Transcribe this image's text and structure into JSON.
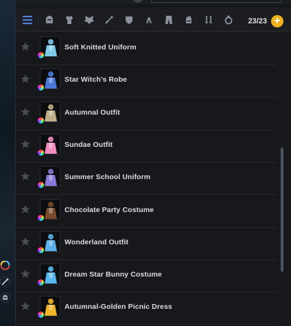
{
  "header": {
    "count": "23/23",
    "add_label": "+"
  },
  "toolbar": {
    "filters": [
      {
        "icon": "list-menu-icon"
      },
      {
        "icon": "helmet-icon"
      },
      {
        "icon": "armor-icon"
      },
      {
        "icon": "wings-icon"
      },
      {
        "icon": "sword-icon"
      },
      {
        "icon": "shield-icon"
      },
      {
        "icon": "claw-icon"
      },
      {
        "icon": "pants-icon"
      },
      {
        "icon": "gauntlet-icon"
      },
      {
        "icon": "dual-blades-icon"
      },
      {
        "icon": "ring-icon"
      }
    ]
  },
  "items": [
    {
      "name": "Soft Knitted Uniform",
      "color": "#7ec8e8"
    },
    {
      "name": "Star Witch’s Robe",
      "color": "#4a7ad8"
    },
    {
      "name": "Autumnal Outfit",
      "color": "#bfae8a"
    },
    {
      "name": "Sundae Outfit",
      "color": "#f08cc0"
    },
    {
      "name": "Summer School Uniform",
      "color": "#8a78d8"
    },
    {
      "name": "Chocolate Party Costume",
      "color": "#7a4a2a"
    },
    {
      "name": "Wonderland Outfit",
      "color": "#5ab0e8"
    },
    {
      "name": "Dream Star Bunny Costume",
      "color": "#58b8f0"
    },
    {
      "name": "Autumnal-Golden Picnic Dress",
      "color": "#f0b428"
    }
  ],
  "accent": "#f2b21c"
}
